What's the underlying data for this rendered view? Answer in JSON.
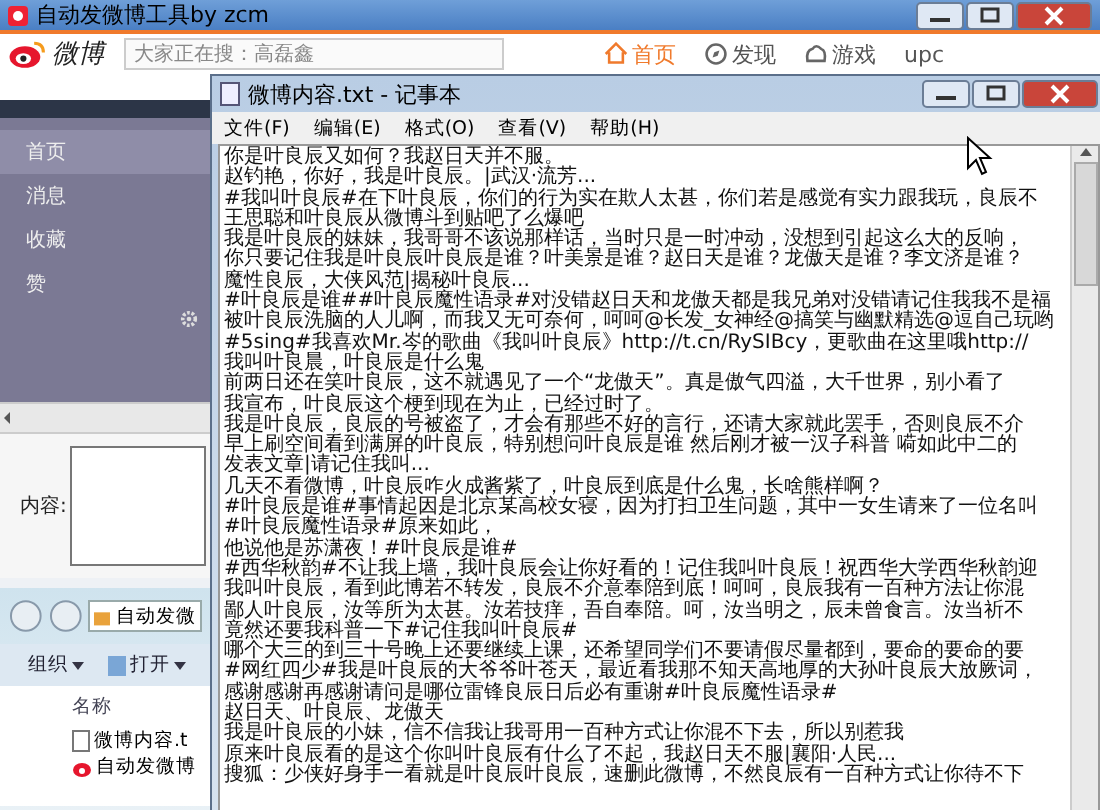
{
  "app_window": {
    "title": "自动发微博工具by zcm"
  },
  "weibo": {
    "logo": "微博",
    "search": {
      "placeholder": "大家正在搜：高磊鑫"
    },
    "nav": [
      {
        "label": "首页",
        "selected": true
      },
      {
        "label": "发现",
        "selected": false
      },
      {
        "label": "游戏",
        "selected": false
      }
    ],
    "user": "upc"
  },
  "sidebar": {
    "items": [
      {
        "label": "首页",
        "selected": true
      },
      {
        "label": "消息",
        "selected": false
      },
      {
        "label": "收藏",
        "selected": false
      },
      {
        "label": "赞",
        "selected": false
      }
    ]
  },
  "content_form": {
    "label": "内容:"
  },
  "explorer": {
    "path": "自动发微",
    "toolbar": [
      "组织",
      "打开"
    ],
    "column": "名称",
    "files": [
      {
        "name": "微博内容.t",
        "kind": "text"
      },
      {
        "name": "自动发微博",
        "kind": "app"
      }
    ]
  },
  "notepad": {
    "title": "微博内容.txt - 记事本",
    "menu": [
      "文件(F)",
      "编辑(E)",
      "格式(O)",
      "查看(V)",
      "帮助(H)"
    ],
    "lines": [
      "你是叶良辰又如何？我赵日天并不服。",
      "赵钓艳，你好，我是叶良辰。|武汉·流芳...",
      "#我叫叶良辰#在下叶良辰，你们的行为实在欺人太甚，你们若是感觉有实力跟我玩，良辰不",
      "王思聪和叶良辰从微博斗到贴吧了么爆吧",
      "我是叶良辰的妹妹，我哥哥不该说那样话，当时只是一时冲动，没想到引起这么大的反响，",
      "你只要记住我是叶良辰叶良辰是谁？叶美景是谁？赵日天是谁？龙傲天是谁？李文济是谁？",
      "魔性良辰，大侠风范|揭秘叶良辰...",
      "#叶良辰是谁##叶良辰魔性语录#对没错赵日天和龙傲天都是我兄弟对没错请记住我我不是福",
      "被叶良辰洗脑的人儿啊，而我又无可奈何，呵呵@长发_女神经@搞笑与幽默精选@逗自己玩哟",
      "#5sing#我喜欢Mr.岑的歌曲《我叫叶良辰》http://t.cn/RySIBcy，更歌曲在这里哦http://",
      "我叫叶良晨，叶良辰是什么鬼",
      "前两日还在笑叶良辰，这不就遇见了一个“龙傲天”。真是傲气四溢，大千世界，别小看了",
      "我宣布，叶良辰这个梗到现在为止，已经过时了。",
      "我是叶良辰，良辰的号被盗了，才会有那些不好的言行，还请大家就此罢手，否则良辰不介",
      "早上刷空间看到满屏的叶良辰，特别想问叶良辰是谁 然后刚才被一汉子科普 嗬如此中二的",
      "发表文章|请记住我叫...",
      "几天不看微博，叶良辰咋火成酱紫了，叶良辰到底是什么鬼，长啥熊样啊？",
      "#叶良辰是谁#事情起因是北京某高校女寝，因为打扫卫生问题，其中一女生请来了一位名叫",
      "#叶良辰魔性语录#原来如此，",
      "他说他是苏潇夜！#叶良辰是谁#",
      "#西华秋韵#不让我上墙，我叶良辰会让你好看的！记住我叫叶良辰！祝西华大学西华秋韵迎",
      "我叫叶良辰，看到此博若不转发，良辰不介意奉陪到底！呵呵，良辰我有一百种方法让你混",
      "鄙人叶良辰，汝等所为太甚。汝若技痒，吾自奉陪。呵，汝当明之，辰未曾食言。汝当祈不",
      "竟然还要我科普一下#记住我叫叶良辰#",
      "哪个大三的到三十号晚上还要继续上课，还希望同学们不要请假尽量都到，要命的要命的要",
      "#网红四少#我是叶良辰的大爷爷叶苍天，最近看我那不知天高地厚的大孙叶良辰大放厥词，",
      "感谢感谢再感谢请问是哪位雷锋良辰日后必有重谢#叶良辰魔性语录#",
      "赵日天、叶良辰、龙傲天",
      "我是叶良辰的小妹，信不信我让我哥用一百种方式让你混不下去，所以别惹我",
      "原来叶良辰看的是这个你叫叶良辰有什么了不起，我赵日天不服|襄阳·人民...",
      "搜狐：少侠好身手一看就是叶良辰叶良辰，速删此微博，不然良辰有一百种方式让你待不下"
    ]
  }
}
